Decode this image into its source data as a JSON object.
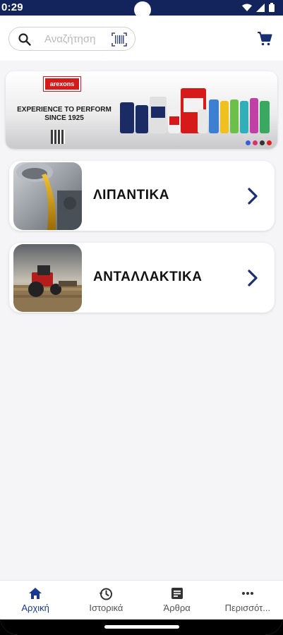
{
  "status_bar": {
    "time": "0:29"
  },
  "search": {
    "placeholder": "Αναζήτηση"
  },
  "banner": {
    "brand": "arexons",
    "tagline_line1": "EXPERIENCE TO PERFORM",
    "tagline_line2": "SINCE 1925"
  },
  "categories": [
    {
      "label": "ΛΙΠΑΝΤΙΚΑ"
    },
    {
      "label": "ΑΝΤΑΛΛΑΚΤΙΚΑ"
    }
  ],
  "bottom_nav": {
    "items": [
      {
        "label": "Αρχική",
        "icon": "home-icon",
        "active": true
      },
      {
        "label": "Ιστορικά",
        "icon": "history-icon"
      },
      {
        "label": "Άρθρα",
        "icon": "articles-icon"
      },
      {
        "label": "Περισσότ...",
        "icon": "more-icon"
      }
    ]
  },
  "colors": {
    "status_bar": "#13235b",
    "accent": "#1a3a8f",
    "chevron": "#1a2f73",
    "brand_red": "#d61a1a"
  }
}
